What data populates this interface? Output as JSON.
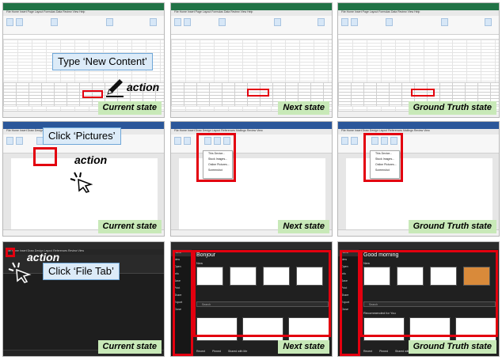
{
  "rows": [
    {
      "instruction": "Type ‘New Content’",
      "action_label": "action",
      "states": [
        "Current state",
        "Next state",
        "Ground Truth state"
      ]
    },
    {
      "instruction": "Click ‘Pictures’",
      "action_label": "action",
      "states": [
        "Current state",
        "Next state",
        "Ground Truth state"
      ],
      "ribbon_button": "Pictures"
    },
    {
      "instruction": "Click ‘File Tab’",
      "action_label": "action",
      "states": [
        "Current state",
        "Next state",
        "Ground Truth state"
      ],
      "next_title": "Bonjour",
      "gt_title": "Good morning",
      "new_label": "New",
      "search_placeholder": "Search",
      "recommended_label": "Recommended for You",
      "bottom_tabs": [
        "Recent",
        "Pinned",
        "Shared with Me"
      ]
    }
  ],
  "colors": {
    "highlight": "#e3000f",
    "state_label_bg": "#c8e9b8",
    "instruction_bg": "#dcebf8",
    "excel_green": "#217346",
    "word_blue": "#2b579a"
  },
  "icons": [
    "pencil-icon",
    "click-cursor-icon"
  ]
}
